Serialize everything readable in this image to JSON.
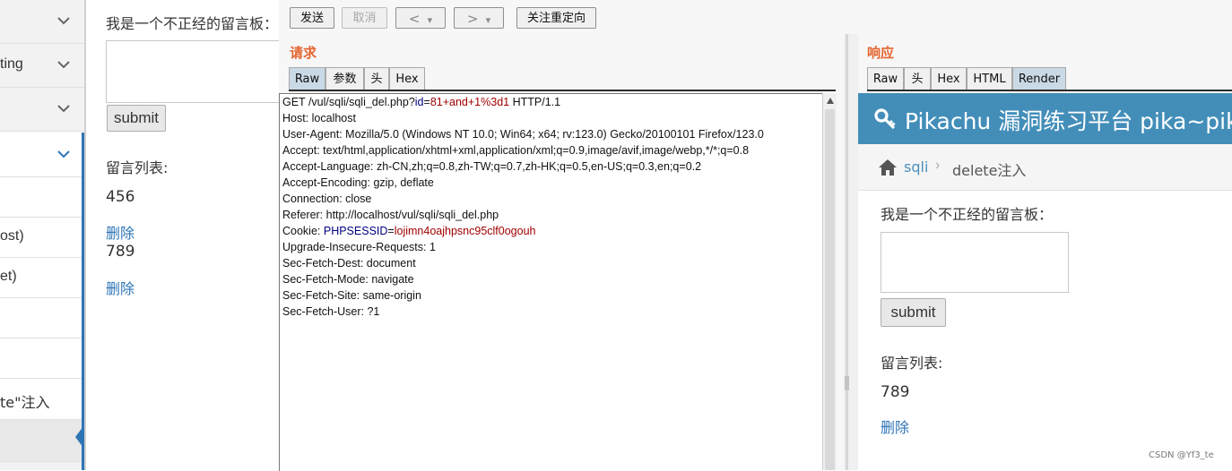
{
  "sidebar": {
    "items": [
      {
        "label": ""
      },
      {
        "label": "ting"
      },
      {
        "label": ""
      },
      {
        "label": ""
      },
      {
        "label": ""
      },
      {
        "label": "ost)"
      },
      {
        "label": "et)"
      },
      {
        "label": ""
      },
      {
        "label": ""
      },
      {
        "label": "te\"注入"
      },
      {
        "label": ""
      }
    ]
  },
  "background_page": {
    "board_label": "我是一个不正经的留言板：",
    "submit_label": "submit",
    "list_label": "留言列表:",
    "messages": [
      {
        "text": "456",
        "delete": "删除"
      },
      {
        "text": "789",
        "delete": "删除"
      }
    ]
  },
  "toolbar": {
    "send": "发送",
    "cancel": "取消",
    "back": "<",
    "forward": ">",
    "dropdown": "▾",
    "follow_redirect": "关注重定向"
  },
  "request": {
    "title": "请求",
    "tabs": [
      "Raw",
      "参数",
      "头",
      "Hex"
    ],
    "active_tab": "Raw",
    "line1": {
      "a": "GET /vul/sqli/sqli_del.php?",
      "k": "id",
      "eq": "=",
      "v": "81+and+1%3d1",
      "b": " HTTP/1.1"
    },
    "headers": [
      "Host: localhost",
      "User-Agent: Mozilla/5.0 (Windows NT 10.0; Win64; x64; rv:123.0) Gecko/20100101 Firefox/123.0",
      "Accept: text/html,application/xhtml+xml,application/xml;q=0.9,image/avif,image/webp,*/*;q=0.8",
      "Accept-Language: zh-CN,zh;q=0.8,zh-TW;q=0.7,zh-HK;q=0.5,en-US;q=0.3,en;q=0.2",
      "Accept-Encoding: gzip, deflate",
      "Connection: close",
      "Referer: http://localhost/vul/sqli/sqli_del.php"
    ],
    "cookie": {
      "a": "Cookie: ",
      "k": "PHPSESSID",
      "eq": "=",
      "v": "lojimn4oajhpsnc95clf0ogouh"
    },
    "headers2": [
      "Upgrade-Insecure-Requests: 1",
      "Sec-Fetch-Dest: document",
      "Sec-Fetch-Mode: navigate",
      "Sec-Fetch-Site: same-origin",
      "Sec-Fetch-User: ?1"
    ]
  },
  "response": {
    "title": "响应",
    "tabs": [
      "Raw",
      "头",
      "Hex",
      "HTML",
      "Render"
    ],
    "active_tab": "Render",
    "render": {
      "site_title": "Pikachu 漏洞练习平台 pika~pika~",
      "crumb_link": "sqli",
      "crumb_sep": "›",
      "crumb_current": "delete注入",
      "board_label": "我是一个不正经的留言板：",
      "submit_label": "submit",
      "list_label": "留言列表:",
      "message": "789",
      "delete": "删除"
    }
  },
  "watermark": "CSDN @Yf3_te",
  "colors": {
    "accent_orange": "#e4652f",
    "header_blue": "#438eb9",
    "link_blue": "#2e75b6"
  }
}
